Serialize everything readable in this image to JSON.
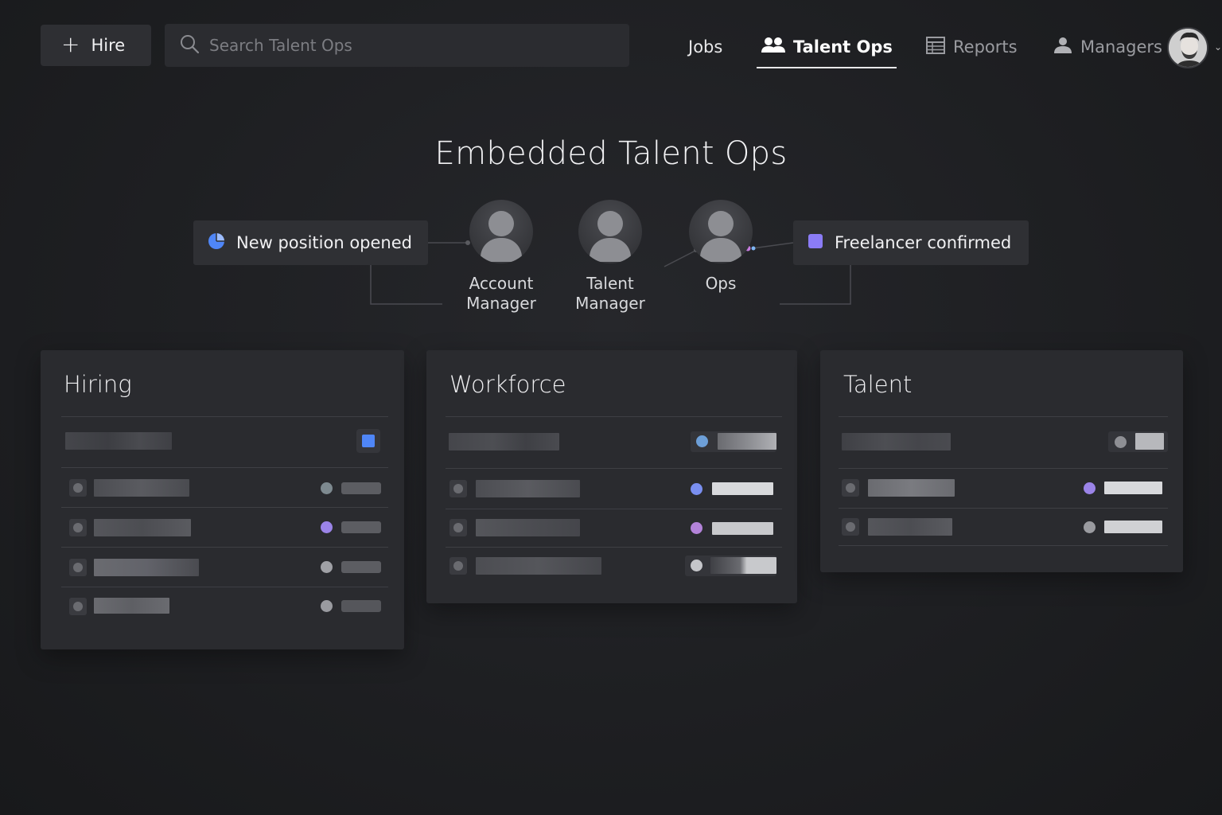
{
  "topbar": {
    "hire_label": "Hire",
    "search_placeholder": "Search Talent Ops",
    "nav": [
      {
        "label": "Jobs",
        "icon": "none",
        "state": "normal"
      },
      {
        "label": "Talent Ops",
        "icon": "people-icon",
        "state": "active"
      },
      {
        "label": "Reports",
        "icon": "table-icon",
        "state": "muted"
      },
      {
        "label": "Managers",
        "icon": "person-icon",
        "state": "muted"
      }
    ]
  },
  "page": {
    "title": "Embedded Talent Ops"
  },
  "flow": {
    "start": {
      "label": "New position opened",
      "icon": "pie-icon",
      "color": "#4f86f7"
    },
    "end": {
      "label": "Freelancer confirmed",
      "icon": "square-icon",
      "color": "#8b7cf6"
    },
    "roles": [
      {
        "label_line1": "Account",
        "label_line2": "Manager"
      },
      {
        "label_line1": "Talent",
        "label_line2": "Manager"
      },
      {
        "label_line1": "Ops",
        "label_line2": ""
      }
    ]
  },
  "cards": [
    {
      "title": "Hiring"
    },
    {
      "title": "Workforce"
    },
    {
      "title": "Talent"
    }
  ],
  "colors": {
    "accent_blue": "#4f86f7",
    "accent_purple": "#9b84e8",
    "dot_gray": "#8e8f94",
    "dot_teal": "#7e9aa6"
  }
}
